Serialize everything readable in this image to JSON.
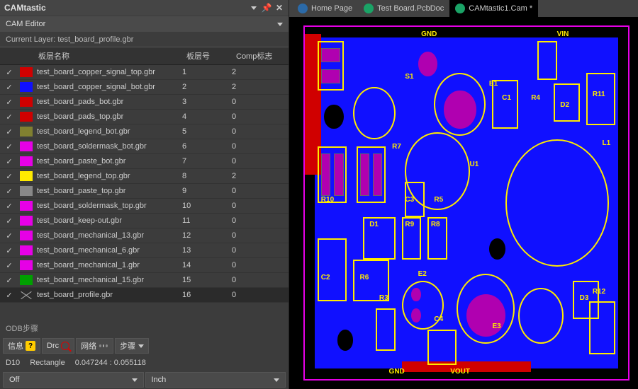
{
  "panel": {
    "title": "CAMtastic",
    "editor_label": "CAM Editor",
    "current_layer_prefix": "Current Layer: ",
    "current_layer": "test_board_profile.gbr",
    "odb_label": "ODB步骤",
    "headers": {
      "name": "板层名称",
      "num": "板层号",
      "comp": "Comp标志"
    },
    "layers": [
      {
        "color": "#d00000",
        "name": "test_board_copper_signal_top.gbr",
        "num": "1",
        "comp": "2"
      },
      {
        "color": "#1010ff",
        "name": "test_board_copper_signal_bot.gbr",
        "num": "2",
        "comp": "2"
      },
      {
        "color": "#d00000",
        "name": "test_board_pads_bot.gbr",
        "num": "3",
        "comp": "0"
      },
      {
        "color": "#d00000",
        "name": "test_board_pads_top.gbr",
        "num": "4",
        "comp": "0"
      },
      {
        "color": "#808030",
        "name": "test_board_legend_bot.gbr",
        "num": "5",
        "comp": "0"
      },
      {
        "color": "#e600e6",
        "name": "test_board_soldermask_bot.gbr",
        "num": "6",
        "comp": "0"
      },
      {
        "color": "#e600e6",
        "name": "test_board_paste_bot.gbr",
        "num": "7",
        "comp": "0"
      },
      {
        "color": "#ffeb00",
        "name": "test_board_legend_top.gbr",
        "num": "8",
        "comp": "2"
      },
      {
        "color": "#888888",
        "name": "test_board_paste_top.gbr",
        "num": "9",
        "comp": "0"
      },
      {
        "color": "#e600e6",
        "name": "test_board_soldermask_top.gbr",
        "num": "10",
        "comp": "0"
      },
      {
        "color": "#e600e6",
        "name": "test_board_keep-out.gbr",
        "num": "11",
        "comp": "0"
      },
      {
        "color": "#e600e6",
        "name": "test_board_mechanical_13.gbr",
        "num": "12",
        "comp": "0"
      },
      {
        "color": "#e600e6",
        "name": "test_board_mechanical_6.gbr",
        "num": "13",
        "comp": "0"
      },
      {
        "color": "#e600e6",
        "name": "test_board_mechanical_1.gbr",
        "num": "14",
        "comp": "0"
      },
      {
        "color": "#00a000",
        "name": "test_board_mechanical_15.gbr",
        "num": "15",
        "comp": "0"
      },
      {
        "color": "x",
        "name": "test_board_profile.gbr",
        "num": "16",
        "comp": "0",
        "sel": true
      }
    ],
    "buttons": {
      "info": "信息",
      "drc": "Drc",
      "net": "网络",
      "step": "步骤"
    },
    "status": {
      "d": "D10",
      "shape": "Rectangle",
      "coords": "0.047244 : 0.055118"
    },
    "combos": {
      "left": "Off",
      "right": "Inch"
    }
  },
  "tabs": [
    {
      "label": "Home Page",
      "icon": "#2b6aa8"
    },
    {
      "label": "Test Board.PcbDoc",
      "icon": "#1aa366"
    },
    {
      "label": "CAMtastic1.Cam *",
      "icon": "#1aa366",
      "active": true
    }
  ],
  "board": {
    "labels": [
      "GND",
      "VIN",
      "S1",
      "E1",
      "C1",
      "R4",
      "D2",
      "R11",
      "L1",
      "R7",
      "U1",
      "R10",
      "C3",
      "R5",
      "D1",
      "R9",
      "R8",
      "C2",
      "R6",
      "E2",
      "R3",
      "C4",
      "E3",
      "D3",
      "R12",
      "GND",
      "VOUT"
    ]
  }
}
